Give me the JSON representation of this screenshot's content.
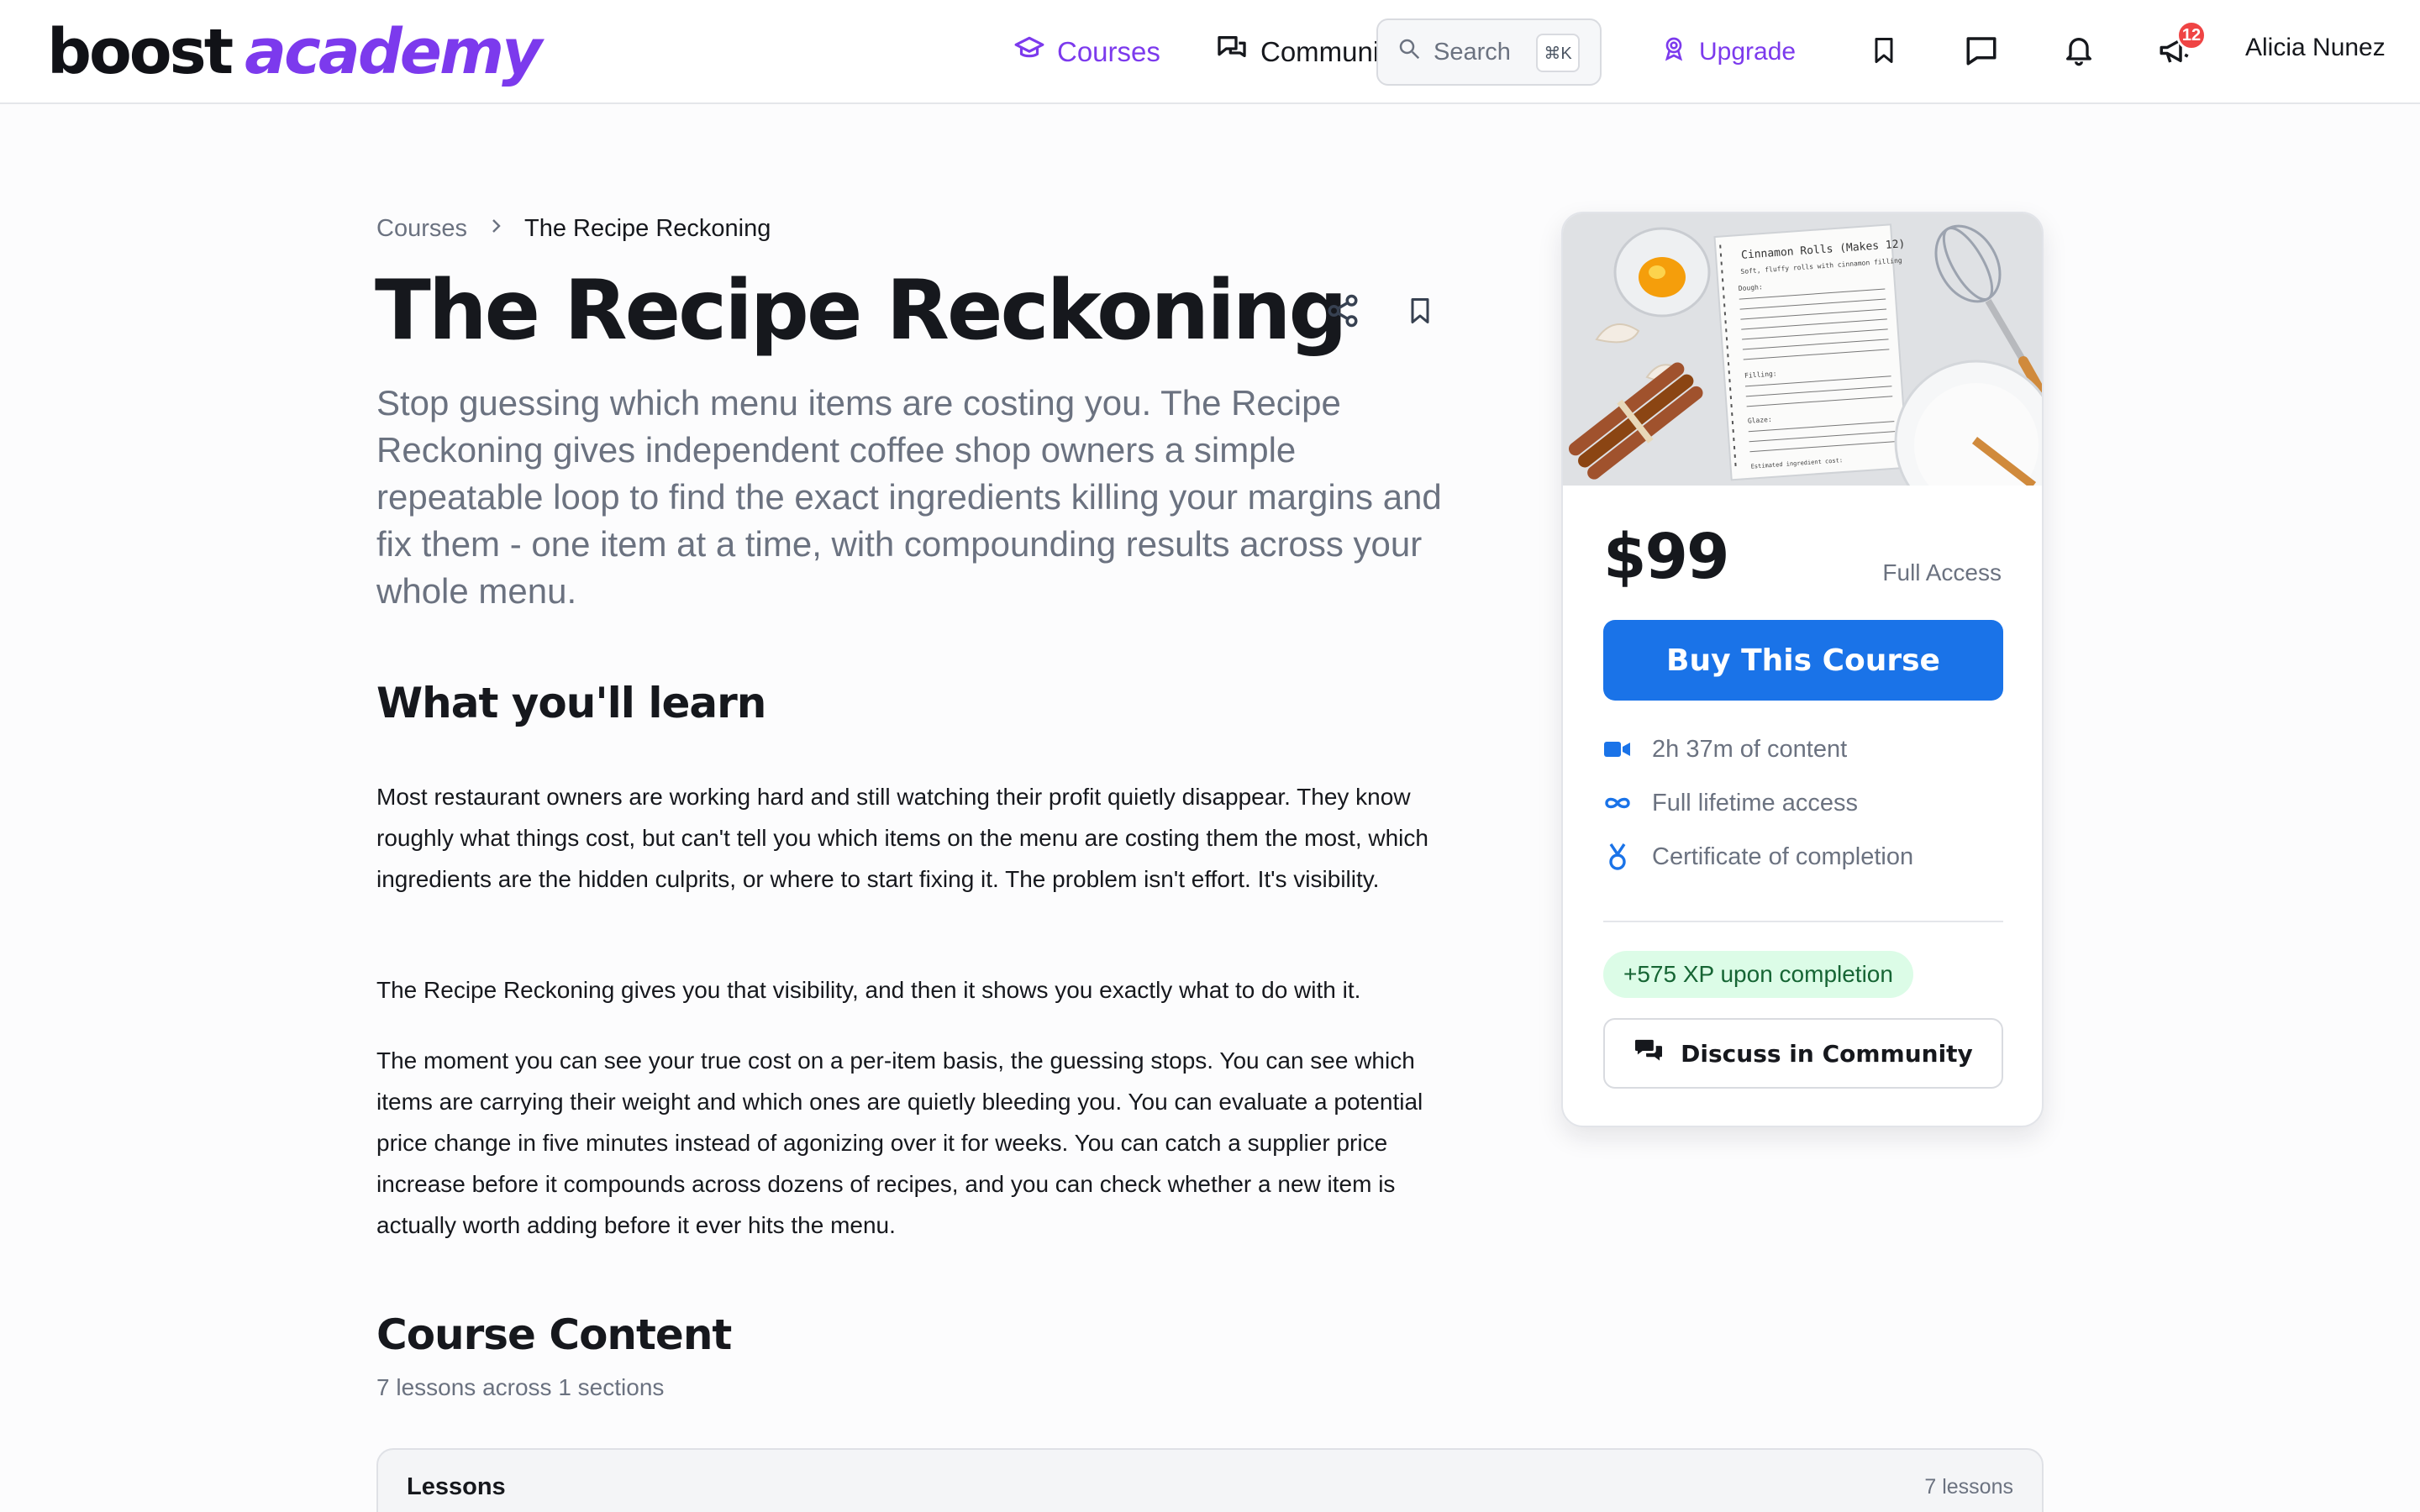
{
  "brand": {
    "logo_part1": "boost",
    "logo_part2": "academy",
    "accent": "#7c3aed"
  },
  "nav": {
    "courses_label": "Courses",
    "community_label": "Community",
    "search_placeholder": "Search",
    "search_shortcut": "⌘K",
    "upgrade_label": "Upgrade",
    "icons": [
      "bookmark-icon",
      "chat-icon",
      "bell-icon",
      "megaphone-icon"
    ],
    "notifications_count": "12",
    "user_name": "Alicia Nunez"
  },
  "breadcrumb": {
    "root": "Courses",
    "current": "The Recipe Reckoning"
  },
  "course": {
    "title": "The Recipe Reckoning",
    "subtitle": "Stop guessing which menu items are costing you. The Recipe Reckoning gives independent coffee shop owners a simple repeatable loop to find the exact ingredients killing your margins and fix them - one item at a time, with compounding results across your whole menu."
  },
  "learn": {
    "heading": "What you'll learn",
    "paragraphs": [
      "Most restaurant owners are working hard and still watching their profit quietly disappear. They know roughly what things cost, but can't tell you which items on the menu are costing them the most, which ingredients are the hidden culprits, or where to start fixing it. The problem isn't effort. It's visibility.",
      "The Recipe Reckoning gives you that visibility, and then it shows you exactly what to do with it.",
      "The moment you can see your true cost on a per-item basis, the guessing stops. You can see which items are carrying their weight and which ones are quietly bleeding you. You can evaluate a potential price change in five minutes instead of agonizing over it for weeks. You can catch a supplier price increase before it compounds across dozens of recipes, and you can check whether a new item is actually worth adding before it ever hits the menu."
    ]
  },
  "content": {
    "heading": "Course Content",
    "meta": "7 lessons across 1 sections",
    "lessons_label": "Lessons",
    "lessons_count": "7 lessons"
  },
  "purchase": {
    "thumbnail_card": {
      "title": "Cinnamon Rolls (Makes 12)",
      "subtitle": "Soft, fluffy rolls with cinnamon filling",
      "sections": [
        "Dough:",
        "Filling:",
        "Glaze:"
      ],
      "total_label": "Estimated ingredient cost:"
    },
    "price": "$99",
    "tier": "Full Access",
    "buy_label": "Buy This Course",
    "features": [
      {
        "icon": "video-icon",
        "text": "2h 37m of content"
      },
      {
        "icon": "infinity-icon",
        "text": "Full lifetime access"
      },
      {
        "icon": "medal-icon",
        "text": "Certificate of completion"
      }
    ],
    "xp_label": "+575 XP upon completion",
    "discuss_label": "Discuss in Community",
    "button_color": "#1a73e8",
    "xp_color": "#dcfce7"
  }
}
